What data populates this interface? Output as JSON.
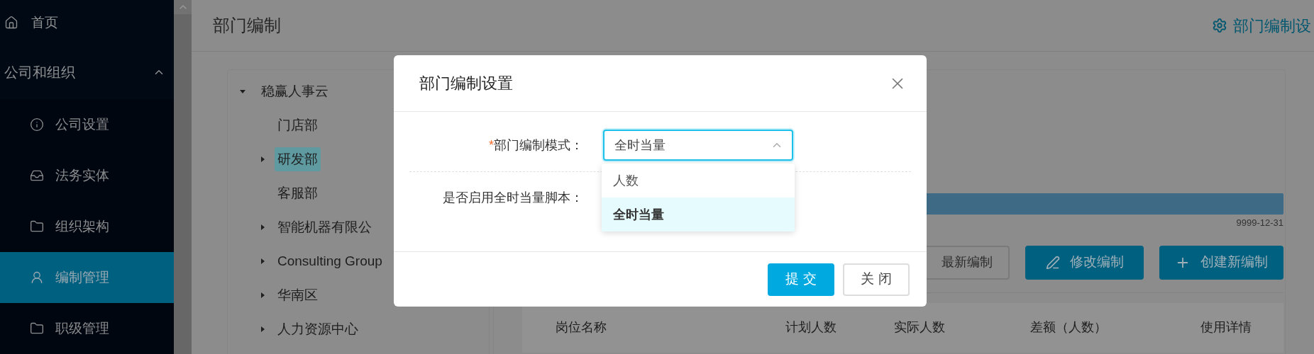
{
  "sidebar": {
    "items": [
      {
        "label": "首页",
        "kind": "link"
      },
      {
        "label": "公司和组织",
        "kind": "group",
        "expanded": true,
        "children": [
          {
            "label": "公司设置",
            "selected": false
          },
          {
            "label": "法务实体",
            "selected": false
          },
          {
            "label": "组织架构",
            "selected": false
          },
          {
            "label": "编制管理",
            "selected": true
          },
          {
            "label": "职级管理",
            "selected": false
          }
        ]
      }
    ]
  },
  "page": {
    "title": "部门编制",
    "settings_link": "部门编制设"
  },
  "tree": [
    {
      "label": "稳赢人事云",
      "expandable": true,
      "expanded": true,
      "selected": false,
      "children": [
        {
          "label": "门店部",
          "expandable": false,
          "selected": false
        },
        {
          "label": "研发部",
          "expandable": true,
          "selected": true
        },
        {
          "label": "客服部",
          "expandable": false,
          "selected": false
        },
        {
          "label": "智能机器有限公",
          "expandable": true,
          "selected": false
        },
        {
          "label": "Consulting Group",
          "expandable": true,
          "selected": false
        },
        {
          "label": "华南区",
          "expandable": true,
          "selected": false
        },
        {
          "label": "人力资源中心",
          "expandable": true,
          "selected": false
        }
      ]
    }
  ],
  "timeline": {
    "end_date": "9999-12-31"
  },
  "actions": [
    {
      "label": "最新编制",
      "kind": "outline"
    },
    {
      "label": "修改编制",
      "kind": "edit"
    },
    {
      "label": "创建新编制",
      "kind": "create"
    }
  ],
  "table": {
    "columns": [
      "岗位名称",
      "计划人数",
      "实际人数",
      "差额（人数）",
      "使用详情"
    ]
  },
  "dialog": {
    "title": "部门编制设置",
    "fields": [
      {
        "kind": "select",
        "required_mark": "*",
        "label": "部门编制模式：",
        "value": "全时当量",
        "open": true,
        "options": [
          {
            "label": "人数",
            "selected": false
          },
          {
            "label": "全时当量",
            "selected": true
          }
        ]
      },
      {
        "kind": "text",
        "label": "是否启用全时当量脚本："
      }
    ],
    "buttons": [
      {
        "label": "提 交",
        "kind": "primary"
      },
      {
        "label": "关 闭",
        "kind": "default"
      }
    ]
  }
}
